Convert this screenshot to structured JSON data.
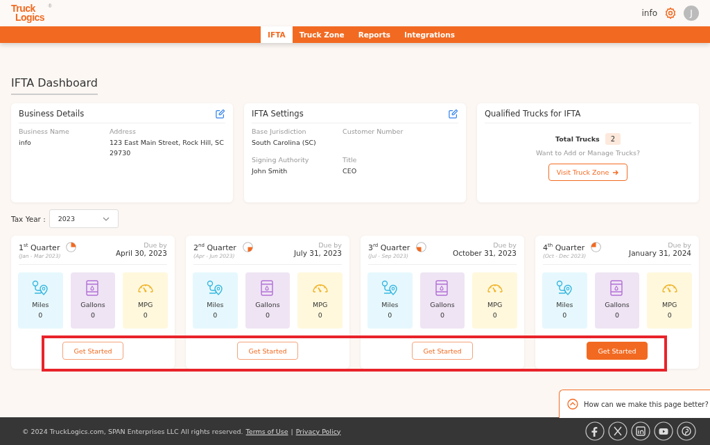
{
  "header": {
    "logo_top": "Truck",
    "logo_bottom": "Logics",
    "logo_mark": "®",
    "user_name": "info",
    "avatar_initial": "J"
  },
  "nav": [
    {
      "label": "IFTA",
      "selected": true
    },
    {
      "label": "Truck Zone",
      "selected": false
    },
    {
      "label": "Reports",
      "selected": false
    },
    {
      "label": "Integrations",
      "selected": false
    }
  ],
  "page_title": "IFTA Dashboard",
  "business_details": {
    "title": "Business Details",
    "fields": [
      {
        "label": "Business Name",
        "value": "info"
      },
      {
        "label": "Address",
        "value": "123 East Main Street, Rock Hill, SC 29730"
      }
    ]
  },
  "ifta_settings": {
    "title": "IFTA Settings",
    "fields": [
      {
        "label": "Base Jurisdiction",
        "value": "South Carolina (SC)"
      },
      {
        "label": "Customer Number"
      },
      {
        "label": "Signing Authority",
        "value": "John Smith"
      },
      {
        "label": "Title",
        "value": "CEO"
      }
    ]
  },
  "qualified_trucks": {
    "title": "Qualified Trucks for IFTA",
    "total_label": "Total Trucks",
    "total": "2",
    "prompt": "Want to Add or Manage Trucks?",
    "button": "Visit Truck Zone"
  },
  "tax_year": {
    "label": "Tax Year :",
    "value": "2023"
  },
  "quarters": [
    {
      "title": "1$^{st}$ Quarter",
      "range": "(Jan - Mar 2023)",
      "due_label": "Due by",
      "due": "April 30, 2023",
      "stats": [
        {
          "kind": "miles",
          "label": "Miles",
          "value": "0"
        },
        {
          "kind": "gallons",
          "label": "Gallons",
          "value": "0"
        },
        {
          "kind": "mpg",
          "label": "MPG",
          "value": "0"
        }
      ],
      "button": {
        "label": "Get Started",
        "kind": "outline"
      }
    },
    {
      "title": "2$^{nd}$ Quarter",
      "range": "(Apr - Jun 2023)",
      "due_label": "Due by",
      "due": "July 31, 2023",
      "stats": [
        {
          "kind": "miles",
          "label": "Miles",
          "value": "0"
        },
        {
          "kind": "gallons",
          "label": "Gallons",
          "value": "0"
        },
        {
          "kind": "mpg",
          "label": "MPG",
          "value": "0"
        }
      ],
      "button": {
        "label": "Get Started",
        "kind": "outline"
      }
    },
    {
      "title": "3$^{rd}$ Quarter",
      "range": "(Jul - Sep 2023)",
      "due_label": "Due by",
      "due": "October 31, 2023",
      "stats": [
        {
          "kind": "miles",
          "label": "Miles",
          "value": "0"
        },
        {
          "kind": "gallons",
          "label": "Gallons",
          "value": "0"
        },
        {
          "kind": "mpg",
          "label": "MPG",
          "value": "0"
        }
      ],
      "button": {
        "label": "Get Started",
        "kind": "outline"
      }
    },
    {
      "title": "4$^{th}$ Quarter",
      "range": "(Oct - Dec 2023)",
      "due_label": "Due by",
      "due": "January 31, 2024",
      "stats": [
        {
          "kind": "miles",
          "label": "Miles",
          "value": "0"
        },
        {
          "kind": "gallons",
          "label": "Gallons",
          "value": "0"
        },
        {
          "kind": "mpg",
          "label": "MPG",
          "value": "0"
        }
      ],
      "button": {
        "label": "Get Started",
        "kind": "filled"
      }
    }
  ],
  "feedback": {
    "label": "How can we make this page better?"
  },
  "footer": {
    "copyright": "© 2024 TruckLogics.com, SPAN Enterprises LLC All rights reserved.",
    "links": [
      "Terms of Use",
      "Privacy Policy"
    ],
    "separator": "|"
  }
}
